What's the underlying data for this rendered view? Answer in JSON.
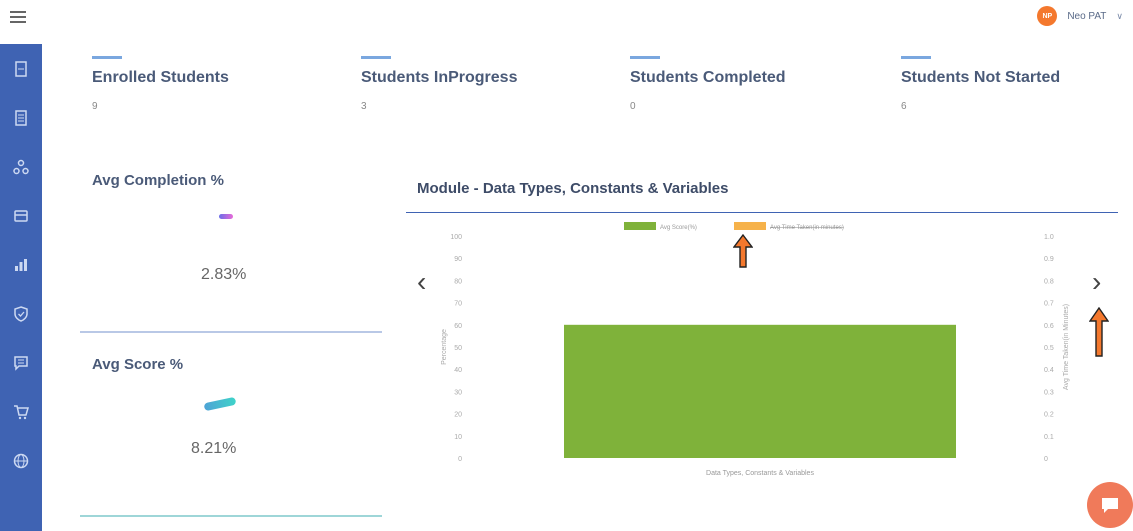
{
  "header": {
    "user_name": "Neo PAT",
    "avatar_initials": "NP",
    "caret": "∨"
  },
  "stats": [
    {
      "title": "Enrolled Students",
      "value": "9"
    },
    {
      "title": "Students InProgress",
      "value": "3"
    },
    {
      "title": "Students Completed",
      "value": "0"
    },
    {
      "title": "Students Not Started",
      "value": "6"
    }
  ],
  "kpis": {
    "avg_completion": {
      "title": "Avg Completion %",
      "value": "2.83%"
    },
    "avg_score": {
      "title": "Avg Score %",
      "value": "8.21%"
    }
  },
  "chart": {
    "title": "Module - Data Types, Constants & Variables",
    "prev": "‹",
    "next": "›"
  },
  "chart_data": {
    "type": "bar",
    "categories": [
      "Data Types, Constants & Variables"
    ],
    "series": [
      {
        "name": "Avg Score(%)",
        "values": [
          60
        ],
        "color": "#7fb23a",
        "axis": "left"
      },
      {
        "name": "Avg Time Taken(in minutes)",
        "values": [
          0
        ],
        "color": "#f6b24a",
        "axis": "right"
      }
    ],
    "ylabel": "Percentage",
    "y2label": "Avg Time Taken(in Minutes)",
    "ylim": [
      0,
      100
    ],
    "y2lim": [
      0,
      1.0
    ],
    "yticks": [
      "0",
      "10",
      "20",
      "30",
      "40",
      "50",
      "60",
      "70",
      "80",
      "90",
      "100"
    ],
    "y2ticks": [
      "0",
      "0.1",
      "0.2",
      "0.3",
      "0.4",
      "0.5",
      "0.6",
      "0.7",
      "0.8",
      "0.9",
      "1.0"
    ],
    "legend": "top",
    "grid": false
  },
  "colors": {
    "sidebar": "#3f63b3",
    "accent_orange": "#f4782d"
  },
  "sidebar_icons": [
    "document-icon",
    "file-icon",
    "sitemap-icon",
    "folder-icon",
    "chart-icon",
    "shield-icon",
    "message-icon",
    "cart-icon",
    "globe-icon"
  ]
}
